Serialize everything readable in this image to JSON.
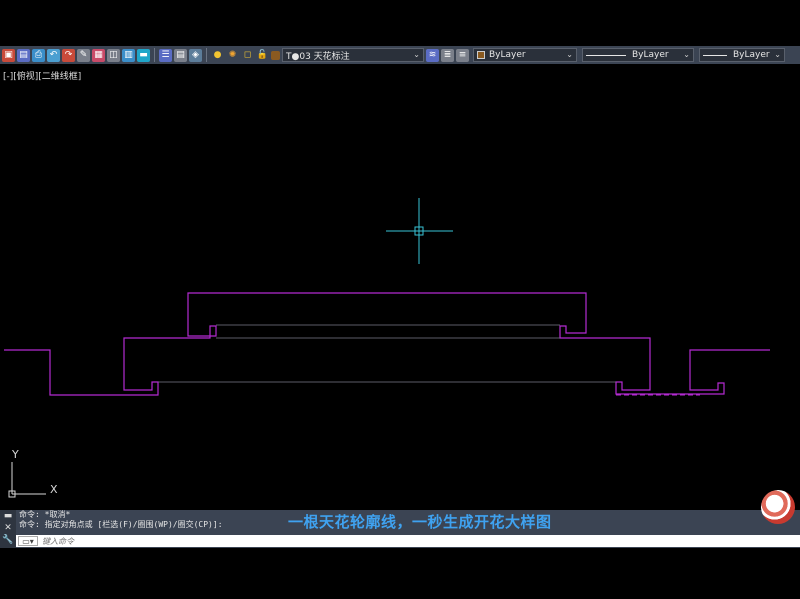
{
  "toolbar": {
    "layer_name": "T●03 天花标注",
    "color_value": "ByLayer",
    "linetype_value": "ByLayer",
    "lineweight_value": "ByLayer",
    "icons": [
      "open-icon",
      "save-icon",
      "print-icon",
      "undo-icon",
      "redo-icon",
      "match-prop-icon",
      "layer-icon",
      "block-icon",
      "properties-icon",
      "sheet-icon",
      "layer-states-icon",
      "bulb-icon",
      "sun-icon",
      "freeze-icon",
      "lock-icon",
      "layer-color-icon",
      "layer-prev-icon",
      "layer-iso-icon",
      "layer-walk-icon"
    ]
  },
  "viewport": {
    "label": "[-][俯视][二维线框]"
  },
  "ucs": {
    "y_label": "Y",
    "x_label": "X"
  },
  "command": {
    "history": [
      "命令: *取消*",
      "命令: 指定对角点或 [栏选(F)/圈围(WP)/圈交(CP)]:"
    ],
    "placeholder": "键入命令"
  },
  "caption": {
    "text": "一根天花轮廓线，一秒生成开花大样图"
  },
  "colors": {
    "profile": "#b32bd1",
    "inner_line": "#7c7c8c",
    "crosshair": "#39c3d6",
    "caption": "#3fa2f0",
    "toolbar_bg": "#3b4453"
  }
}
